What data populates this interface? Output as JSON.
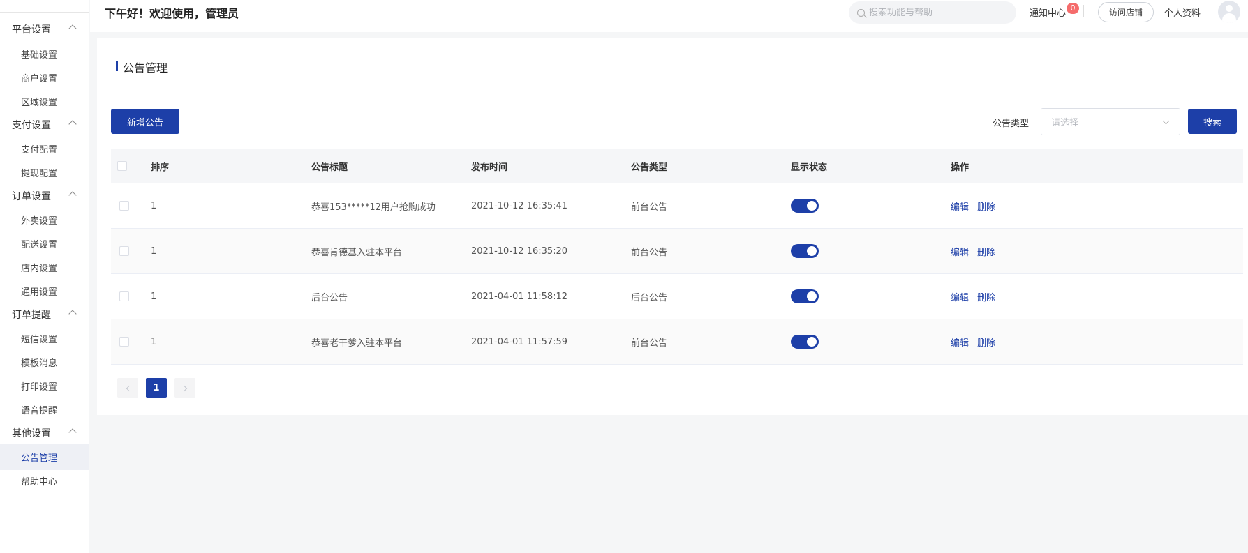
{
  "topbar": {
    "greeting": "下午好！欢迎使用，管理员",
    "search_placeholder": "搜索功能与帮助",
    "notify_label": "通知中心",
    "notify_count": "0",
    "visit_store": "访问店铺",
    "profile": "个人资料"
  },
  "sidebar": {
    "groups": [
      {
        "label": "平台设置",
        "items": [
          "基础设置",
          "商户设置",
          "区域设置"
        ]
      },
      {
        "label": "支付设置",
        "items": [
          "支付配置",
          "提现配置"
        ]
      },
      {
        "label": "订单设置",
        "items": [
          "外卖设置",
          "配送设置",
          "店内设置",
          "通用设置"
        ]
      },
      {
        "label": "订单提醒",
        "items": [
          "短信设置",
          "模板消息",
          "打印设置",
          "语音提醒"
        ]
      },
      {
        "label": "其他设置",
        "items": [
          "公告管理",
          "帮助中心"
        ]
      }
    ],
    "active": "公告管理"
  },
  "page": {
    "title": "公告管理",
    "add_button": "新增公告",
    "filter_label": "公告类型",
    "select_placeholder": "请选择",
    "search_button": "搜索"
  },
  "table": {
    "columns": [
      "排序",
      "公告标题",
      "发布时间",
      "公告类型",
      "显示状态",
      "操作"
    ],
    "rows": [
      {
        "sort": "1",
        "title": "恭喜153*****12用户抢购成功",
        "time": "2021-10-12 16:35:41",
        "type": "前台公告",
        "visible": true
      },
      {
        "sort": "1",
        "title": "恭喜肯德基入驻本平台",
        "time": "2021-10-12 16:35:20",
        "type": "前台公告",
        "visible": true
      },
      {
        "sort": "1",
        "title": "后台公告",
        "time": "2021-04-01 11:58:12",
        "type": "后台公告",
        "visible": true
      },
      {
        "sort": "1",
        "title": "恭喜老干爹入驻本平台",
        "time": "2021-04-01 11:57:59",
        "type": "前台公告",
        "visible": true
      }
    ],
    "actions": {
      "edit": "编辑",
      "delete": "删除"
    }
  },
  "pagination": {
    "current": "1"
  },
  "colors": {
    "primary": "#1d3fa8",
    "badge": "#f56c6c"
  }
}
